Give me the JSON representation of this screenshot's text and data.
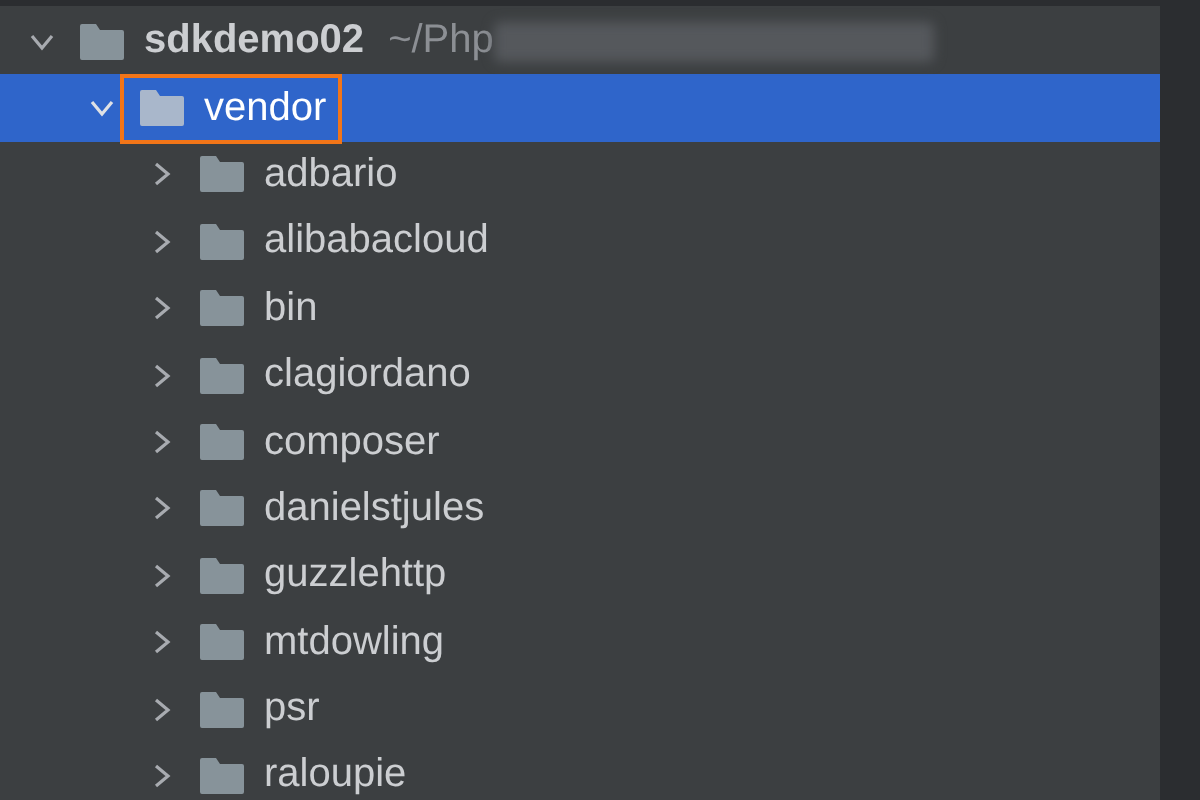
{
  "tree": [
    {
      "name": "sdkdemo02",
      "path": "~/Php",
      "path_redacted": true,
      "bold": true,
      "expanded": true,
      "selected": false,
      "highlighted": false,
      "children": [
        {
          "name": "vendor",
          "expanded": true,
          "selected": true,
          "highlighted": true,
          "children": [
            {
              "name": "adbario",
              "expanded": false,
              "selected": false,
              "highlighted": false
            },
            {
              "name": "alibabacloud",
              "expanded": false,
              "selected": false,
              "highlighted": false
            },
            {
              "name": "bin",
              "expanded": false,
              "selected": false,
              "highlighted": false
            },
            {
              "name": "clagiordano",
              "expanded": false,
              "selected": false,
              "highlighted": false
            },
            {
              "name": "composer",
              "expanded": false,
              "selected": false,
              "highlighted": false
            },
            {
              "name": "danielstjules",
              "expanded": false,
              "selected": false,
              "highlighted": false
            },
            {
              "name": "guzzlehttp",
              "expanded": false,
              "selected": false,
              "highlighted": false
            },
            {
              "name": "mtdowling",
              "expanded": false,
              "selected": false,
              "highlighted": false
            },
            {
              "name": "psr",
              "expanded": false,
              "selected": false,
              "highlighted": false
            },
            {
              "name": "raloupie",
              "expanded": false,
              "selected": false,
              "highlighted": false
            }
          ]
        }
      ]
    }
  ]
}
